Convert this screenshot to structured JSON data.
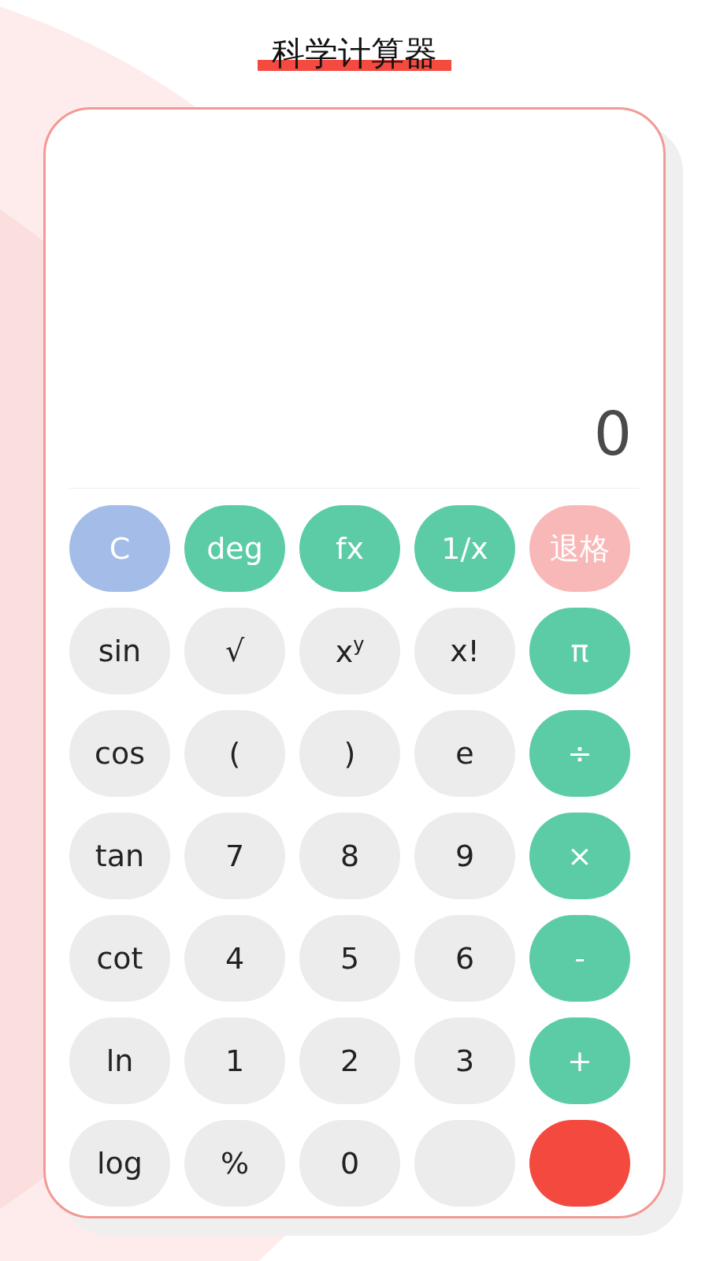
{
  "title": "科学计算器",
  "display": {
    "value": "0"
  },
  "keys": [
    {
      "label": "C",
      "kind": "clear"
    },
    {
      "label": "deg",
      "kind": "function"
    },
    {
      "label": "fx",
      "kind": "function"
    },
    {
      "label": "1/x",
      "kind": "function"
    },
    {
      "label": "退格",
      "kind": "backspace"
    },
    {
      "label": "sin",
      "kind": "plain"
    },
    {
      "label": "√",
      "kind": "plain"
    },
    {
      "label": "x$^{y}$",
      "kind": "plain"
    },
    {
      "label": "x!",
      "kind": "plain"
    },
    {
      "label": "π",
      "kind": "operator"
    },
    {
      "label": "cos",
      "kind": "plain"
    },
    {
      "label": "(",
      "kind": "plain"
    },
    {
      "label": ")",
      "kind": "plain"
    },
    {
      "label": "e",
      "kind": "plain"
    },
    {
      "label": "÷",
      "kind": "operator"
    },
    {
      "label": "tan",
      "kind": "plain"
    },
    {
      "label": "7",
      "kind": "plain"
    },
    {
      "label": "8",
      "kind": "plain"
    },
    {
      "label": "9",
      "kind": "plain"
    },
    {
      "label": "×",
      "kind": "operator"
    },
    {
      "label": "cot",
      "kind": "plain"
    },
    {
      "label": "4",
      "kind": "plain"
    },
    {
      "label": "5",
      "kind": "plain"
    },
    {
      "label": "6",
      "kind": "plain"
    },
    {
      "label": "-",
      "kind": "operator"
    },
    {
      "label": "ln",
      "kind": "plain"
    },
    {
      "label": "1",
      "kind": "plain"
    },
    {
      "label": "2",
      "kind": "plain"
    },
    {
      "label": "3",
      "kind": "plain"
    },
    {
      "label": "+",
      "kind": "operator"
    },
    {
      "label": "log",
      "kind": "plain"
    },
    {
      "label": "%",
      "kind": "plain"
    },
    {
      "label": "0",
      "kind": "plain"
    },
    {
      "kind": "plain"
    },
    {
      "kind": "equals"
    }
  ]
}
